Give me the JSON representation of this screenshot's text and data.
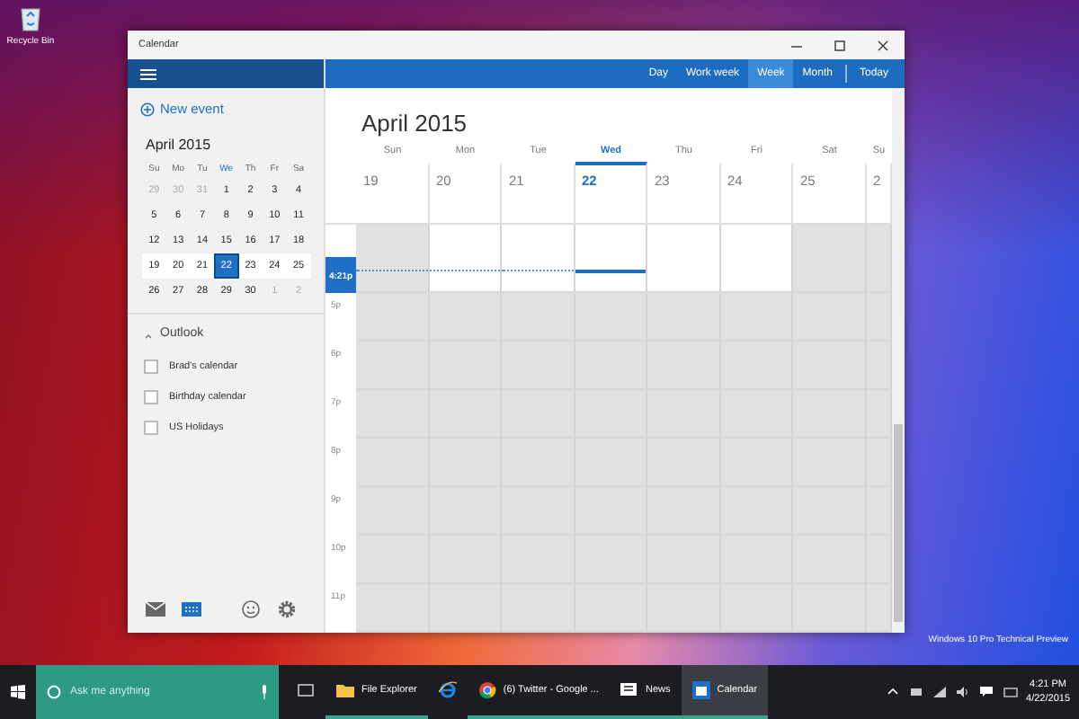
{
  "desktop": {
    "icons": [
      {
        "label": "Recycle Bin"
      }
    ],
    "build_text": "Windows 10 Pro Technical Preview"
  },
  "window": {
    "title": "Calendar"
  },
  "header": {
    "views": [
      {
        "label": "Day",
        "selected": false
      },
      {
        "label": "Work week",
        "selected": false
      },
      {
        "label": "Week",
        "selected": true
      },
      {
        "label": "Month",
        "selected": false
      }
    ],
    "today": "Today"
  },
  "sidebar": {
    "new_event": "New event",
    "mini_calendar": {
      "title": "April 2015",
      "weekdays": [
        {
          "label": "Su",
          "selected": false
        },
        {
          "label": "Mo",
          "selected": false
        },
        {
          "label": "Tu",
          "selected": false
        },
        {
          "label": "We",
          "selected": true
        },
        {
          "label": "Th",
          "selected": false
        },
        {
          "label": "Fr",
          "selected": false
        },
        {
          "label": "Sa",
          "selected": false
        }
      ],
      "weeks": [
        {
          "selected": false,
          "days": [
            {
              "label": "29",
              "outside": true,
              "selected": false
            },
            {
              "label": "30",
              "outside": true,
              "selected": false
            },
            {
              "label": "31",
              "outside": true,
              "selected": false
            },
            {
              "label": "1",
              "outside": false,
              "selected": false
            },
            {
              "label": "2",
              "outside": false,
              "selected": false
            },
            {
              "label": "3",
              "outside": false,
              "selected": false
            },
            {
              "label": "4",
              "outside": false,
              "selected": false
            }
          ]
        },
        {
          "selected": false,
          "days": [
            {
              "label": "5",
              "outside": false,
              "selected": false
            },
            {
              "label": "6",
              "outside": false,
              "selected": false
            },
            {
              "label": "7",
              "outside": false,
              "selected": false
            },
            {
              "label": "8",
              "outside": false,
              "selected": false
            },
            {
              "label": "9",
              "outside": false,
              "selected": false
            },
            {
              "label": "10",
              "outside": false,
              "selected": false
            },
            {
              "label": "11",
              "outside": false,
              "selected": false
            }
          ]
        },
        {
          "selected": false,
          "days": [
            {
              "label": "12",
              "outside": false,
              "selected": false
            },
            {
              "label": "13",
              "outside": false,
              "selected": false
            },
            {
              "label": "14",
              "outside": false,
              "selected": false
            },
            {
              "label": "15",
              "outside": false,
              "selected": false
            },
            {
              "label": "16",
              "outside": false,
              "selected": false
            },
            {
              "label": "17",
              "outside": false,
              "selected": false
            },
            {
              "label": "18",
              "outside": false,
              "selected": false
            }
          ]
        },
        {
          "selected": true,
          "days": [
            {
              "label": "19",
              "outside": false,
              "selected": false
            },
            {
              "label": "20",
              "outside": false,
              "selected": false
            },
            {
              "label": "21",
              "outside": false,
              "selected": false
            },
            {
              "label": "22",
              "outside": false,
              "selected": true
            },
            {
              "label": "23",
              "outside": false,
              "selected": false
            },
            {
              "label": "24",
              "outside": false,
              "selected": false
            },
            {
              "label": "25",
              "outside": false,
              "selected": false
            }
          ]
        },
        {
          "selected": false,
          "days": [
            {
              "label": "26",
              "outside": false,
              "selected": false
            },
            {
              "label": "27",
              "outside": false,
              "selected": false
            },
            {
              "label": "28",
              "outside": false,
              "selected": false
            },
            {
              "label": "29",
              "outside": false,
              "selected": false
            },
            {
              "label": "30",
              "outside": false,
              "selected": false
            },
            {
              "label": "1",
              "outside": true,
              "selected": false
            },
            {
              "label": "2",
              "outside": true,
              "selected": false
            }
          ]
        }
      ]
    },
    "accounts": [
      {
        "name": "Outlook",
        "expanded": true,
        "calendars": [
          {
            "name": "Brad's calendar",
            "checked": false
          },
          {
            "name": "Birthday calendar",
            "checked": false
          },
          {
            "name": "US Holidays",
            "checked": false
          }
        ]
      }
    ],
    "footer": [
      {
        "kind": "mail",
        "selected": false
      },
      {
        "kind": "calendar",
        "selected": true
      },
      {
        "kind": "smiley",
        "selected": false
      },
      {
        "kind": "settings",
        "selected": false
      }
    ]
  },
  "week_view": {
    "title": "April 2015",
    "days": [
      {
        "name": "Sun",
        "date": "19",
        "weekend": true,
        "selected": false
      },
      {
        "name": "Mon",
        "date": "20",
        "weekend": false,
        "selected": false
      },
      {
        "name": "Tue",
        "date": "21",
        "weekend": false,
        "selected": false
      },
      {
        "name": "Wed",
        "date": "22",
        "weekend": false,
        "selected": true
      },
      {
        "name": "Thu",
        "date": "23",
        "weekend": false,
        "selected": false
      },
      {
        "name": "Fri",
        "date": "24",
        "weekend": false,
        "selected": false
      },
      {
        "name": "Sat",
        "date": "25",
        "weekend": true,
        "selected": false
      },
      {
        "name": "Su",
        "date": "2",
        "weekend": true,
        "selected": false
      }
    ],
    "now": {
      "label": "4:21p",
      "working": true
    },
    "hours": [
      {
        "label": "5p",
        "working": false
      },
      {
        "label": "6p",
        "working": false
      },
      {
        "label": "7p",
        "working": false
      },
      {
        "label": "8p",
        "working": false
      },
      {
        "label": "9p",
        "working": false
      },
      {
        "label": "10p",
        "working": false
      },
      {
        "label": "11p",
        "working": false
      }
    ]
  },
  "taskbar": {
    "search": {
      "placeholder": "Ask me anything"
    },
    "apps": [
      {
        "kind": "task_view",
        "running": false,
        "selected": false
      },
      {
        "kind": "folder",
        "label": "File Explorer",
        "running": true,
        "selected": false
      },
      {
        "kind": "ie",
        "running": false,
        "selected": false
      },
      {
        "kind": "chrome",
        "label": "(6) Twitter - Google ...",
        "running": true,
        "selected": false
      },
      {
        "kind": "news",
        "label": "News",
        "running": true,
        "selected": false
      },
      {
        "kind": "calendar",
        "label": "Calendar",
        "running": true,
        "selected": true
      }
    ],
    "clock": {
      "time": "4:21 PM",
      "date": "4/22/2015"
    }
  }
}
